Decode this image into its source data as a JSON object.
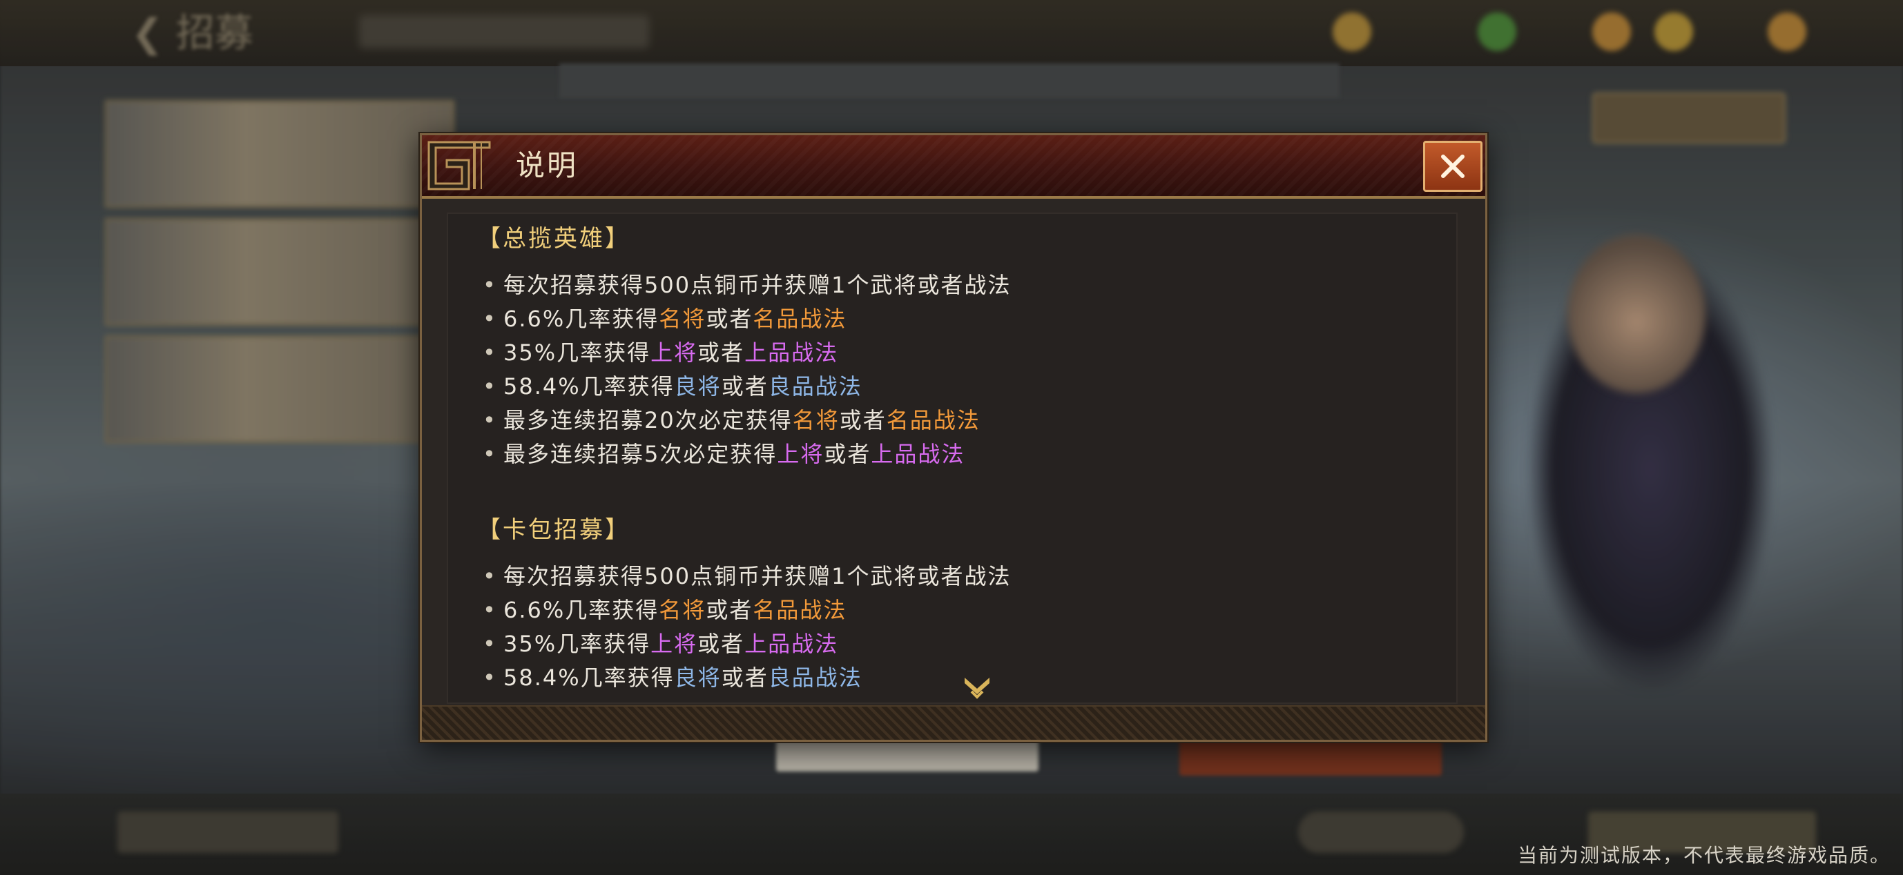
{
  "background": {
    "back_label": "招募",
    "bottom_notice": "当前为测试版本，不代表最终游戏品质。"
  },
  "dialog": {
    "title": "说明",
    "sections": [
      {
        "title": "【总揽英雄】",
        "items": [
          {
            "parts": [
              {
                "text": "每次招募获得500点铜币并获赠1个武将或者战法",
                "color": "white"
              }
            ]
          },
          {
            "parts": [
              {
                "text": "6.6%几率获得",
                "color": "white"
              },
              {
                "text": "名将",
                "color": "orange"
              },
              {
                "text": "或者",
                "color": "white"
              },
              {
                "text": "名品战法",
                "color": "orange"
              }
            ]
          },
          {
            "parts": [
              {
                "text": "35%几率获得",
                "color": "white"
              },
              {
                "text": "上将",
                "color": "purple"
              },
              {
                "text": "或者",
                "color": "white"
              },
              {
                "text": "上品战法",
                "color": "purple"
              }
            ]
          },
          {
            "parts": [
              {
                "text": "58.4%几率获得",
                "color": "white"
              },
              {
                "text": "良将",
                "color": "blue"
              },
              {
                "text": "或者",
                "color": "white"
              },
              {
                "text": "良品战法",
                "color": "blue"
              }
            ]
          },
          {
            "parts": [
              {
                "text": "最多连续招募20次必定获得",
                "color": "white"
              },
              {
                "text": "名将",
                "color": "orange"
              },
              {
                "text": "或者",
                "color": "white"
              },
              {
                "text": "名品战法",
                "color": "orange"
              }
            ]
          },
          {
            "parts": [
              {
                "text": "最多连续招募5次必定获得",
                "color": "white"
              },
              {
                "text": "上将",
                "color": "purple"
              },
              {
                "text": "或者",
                "color": "white"
              },
              {
                "text": "上品战法",
                "color": "purple"
              }
            ]
          }
        ]
      },
      {
        "title": "【卡包招募】",
        "items": [
          {
            "parts": [
              {
                "text": "每次招募获得500点铜币并获赠1个武将或者战法",
                "color": "white"
              }
            ]
          },
          {
            "parts": [
              {
                "text": "6.6%几率获得",
                "color": "white"
              },
              {
                "text": "名将",
                "color": "orange"
              },
              {
                "text": "或者",
                "color": "white"
              },
              {
                "text": "名品战法",
                "color": "orange"
              }
            ]
          },
          {
            "parts": [
              {
                "text": "35%几率获得",
                "color": "white"
              },
              {
                "text": "上将",
                "color": "purple"
              },
              {
                "text": "或者",
                "color": "white"
              },
              {
                "text": "上品战法",
                "color": "purple"
              }
            ]
          },
          {
            "parts": [
              {
                "text": "58.4%几率获得",
                "color": "white"
              },
              {
                "text": "良将",
                "color": "blue"
              },
              {
                "text": "或者",
                "color": "white"
              },
              {
                "text": "良品战法",
                "color": "blue"
              }
            ]
          }
        ]
      }
    ]
  },
  "icons": {
    "close": "close-icon",
    "scroll": "chevron-down-icon"
  },
  "colors": {
    "orange": "#f39a3a",
    "purple": "#d86bf0",
    "blue": "#8fb8e8",
    "section_title": "#f1cf7b",
    "dialog_header": "#5b1f15"
  }
}
